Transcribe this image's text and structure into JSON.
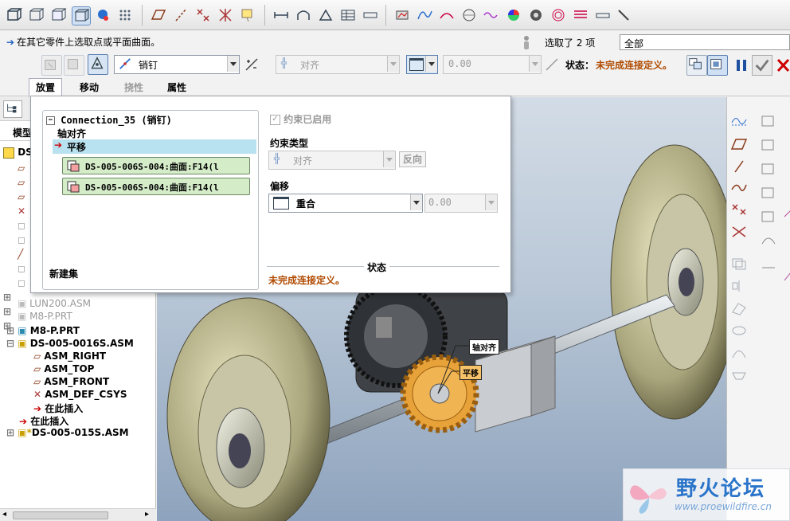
{
  "prompt": "在其它零件上选取点或平面曲面。",
  "selection": {
    "label": "选取了 2 项",
    "filter": "全部"
  },
  "dashboard": {
    "connection_type": "销钉",
    "constraint_type": "对齐",
    "offset_value": "0.00",
    "status_label": "状态：",
    "status_value": "未完成连接定义。"
  },
  "tabs": [
    {
      "label": "放置",
      "state": "active"
    },
    {
      "label": "移动",
      "state": "normal"
    },
    {
      "label": "挠性",
      "state": "disabled"
    },
    {
      "label": "属性",
      "state": "normal"
    }
  ],
  "placement": {
    "connection_name": "Connection_35 (销钉)",
    "items": [
      "轴对齐",
      "平移"
    ],
    "refs": [
      "DS-005-006S-004:曲面:F14(l",
      "DS-005-006S-004:曲面:F14(l"
    ],
    "new_set": "新建集",
    "constraint_enabled": "约束已启用",
    "constraint_type_label": "约束类型",
    "constraint_type_value": "对齐",
    "flip": "反向",
    "offset_label": "偏移",
    "offset_value": "重合",
    "offset_num": "0.00",
    "status_header": "状态",
    "status_text": "未完成连接定义。"
  },
  "model_tree": {
    "header": "模型",
    "rows": [
      {
        "text": "DS",
        "dim": false
      },
      {
        "text": "LUN200.ASM",
        "dim": true
      },
      {
        "text": "M8-P.PRT",
        "dim": true
      },
      {
        "text": "M8-P.PRT",
        "dim": false
      },
      {
        "text": "DS-005-0016S.ASM",
        "dim": false
      },
      {
        "text": "ASM_RIGHT",
        "dim": false
      },
      {
        "text": "ASM_TOP",
        "dim": false
      },
      {
        "text": "ASM_FRONT",
        "dim": false
      },
      {
        "text": "ASM_DEF_CSYS",
        "dim": false
      },
      {
        "text": "在此插入",
        "dim": false
      },
      {
        "text": "在此插入",
        "dim": false
      },
      {
        "text": "DS-005-015S.ASM",
        "dim": false
      }
    ]
  },
  "viewport_labels": [
    "轴对齐",
    "平移"
  ],
  "watermark": {
    "title": "野火论坛",
    "url": "www.proewildfire.cn"
  },
  "colors": {
    "accent": "#1e5fbf",
    "status": "#b04a00",
    "selection": "#b8e2f0"
  }
}
